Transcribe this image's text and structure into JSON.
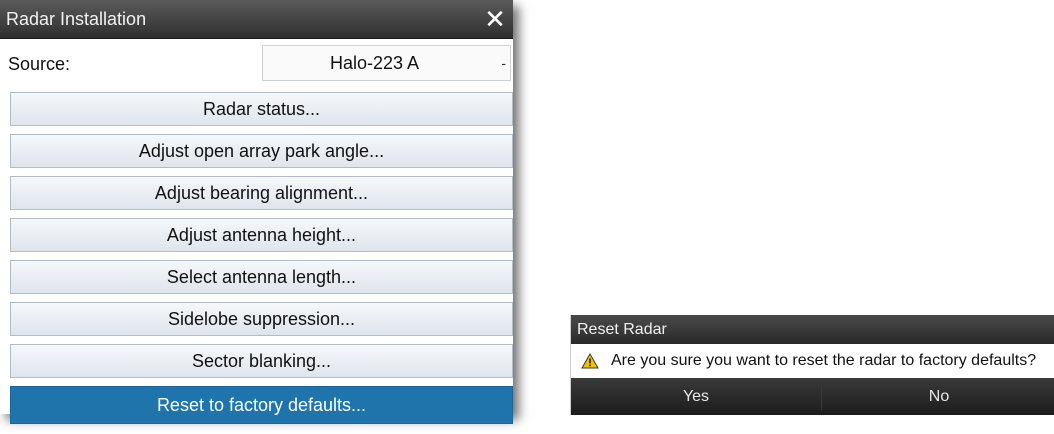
{
  "installation_dialog": {
    "title": "Radar Installation",
    "close_glyph": "✕",
    "source_label": "Source:",
    "source_value": "Halo-223 A",
    "source_caret": "-",
    "items": [
      {
        "label": "Radar status..."
      },
      {
        "label": "Adjust open array park angle..."
      },
      {
        "label": "Adjust bearing alignment..."
      },
      {
        "label": "Adjust antenna height..."
      },
      {
        "label": "Select antenna length..."
      },
      {
        "label": "Sidelobe suppression..."
      },
      {
        "label": "Sector blanking..."
      },
      {
        "label": "Reset to factory defaults...",
        "selected": true
      }
    ],
    "colors": {
      "selected": "#1f74ac",
      "button_bg": "#e6ebf1",
      "title_bg": "#3a3a3a"
    }
  },
  "reset_dialog": {
    "title": "Reset Radar",
    "icon": "warning-icon",
    "message": "Are you sure you want to reset the radar to factory defaults?",
    "yes_label": "Yes",
    "no_label": "No",
    "colors": {
      "warning": "#f2c200",
      "actions_bg": "#2a2a2a"
    }
  }
}
